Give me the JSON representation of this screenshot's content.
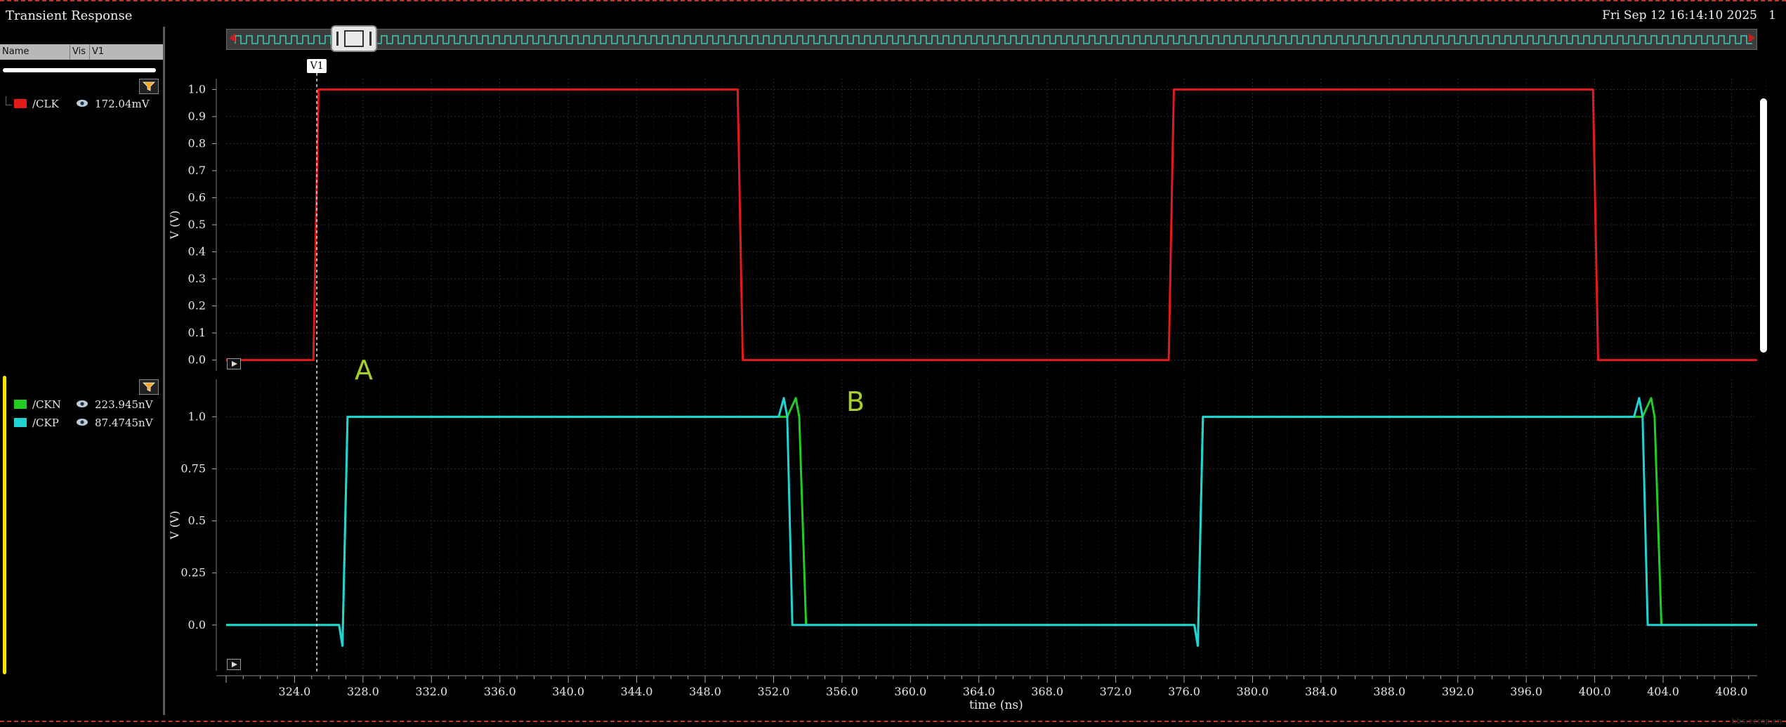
{
  "window": {
    "title": "Transient Response",
    "datetime": "Fri Sep 12 16:14:10 2025",
    "edge_text": "1"
  },
  "legend": {
    "headers": {
      "name": "Name",
      "vis": "Vis",
      "v1": "V1"
    },
    "strip1": [
      {
        "name": "/CLK",
        "value": "172.04mV",
        "color": "#e41a1a"
      }
    ],
    "strip2": [
      {
        "name": "/CKN",
        "value": "223.945nV",
        "color": "#22cc22"
      },
      {
        "name": "/CKP",
        "value": "87.4745nV",
        "color": "#22d3d3"
      }
    ],
    "eye_icon": "eye-icon",
    "filter_icon": "filter-icon"
  },
  "marker": {
    "label": "V1",
    "x_ns": 325.3
  },
  "annotations": {
    "a": "A",
    "b": "B"
  },
  "accent_colors": {
    "panel_bar": "#f2e600",
    "annotation": "#a6cf2a",
    "border": "#c0392b"
  },
  "chart_data": [
    {
      "type": "line",
      "title": "",
      "xlabel": "time (ns)",
      "ylabel": "V (V)",
      "xlim": [
        320.0,
        409.5
      ],
      "ylim": [
        -0.04,
        1.04
      ],
      "yticks": [
        "0.0",
        "0.1",
        "0.2",
        "0.3",
        "0.4",
        "0.5",
        "0.6",
        "0.7",
        "0.8",
        "0.9",
        "1.0"
      ],
      "grid": true,
      "series": [
        {
          "name": "/CLK",
          "color": "#e41a1a",
          "points": [
            [
              320.0,
              0.0
            ],
            [
              325.1,
              0.0
            ],
            [
              325.4,
              1.0
            ],
            [
              349.9,
              1.0
            ],
            [
              350.2,
              0.0
            ],
            [
              375.1,
              0.0
            ],
            [
              375.4,
              1.0
            ],
            [
              399.9,
              1.0
            ],
            [
              400.2,
              0.0
            ],
            [
              409.5,
              0.0
            ]
          ]
        }
      ]
    },
    {
      "type": "line",
      "title": "",
      "xlabel": "time (ns)",
      "ylabel": "V (V)",
      "xlim": [
        320.0,
        409.5
      ],
      "ylim": [
        -0.22,
        1.18
      ],
      "yticks": [
        "0.0",
        "0.25",
        "0.5",
        "0.75",
        "1.0"
      ],
      "xticks": [
        "324.0",
        "328.0",
        "332.0",
        "336.0",
        "340.0",
        "344.0",
        "348.0",
        "352.0",
        "356.0",
        "360.0",
        "364.0",
        "368.0",
        "372.0",
        "376.0",
        "380.0",
        "384.0",
        "388.0",
        "392.0",
        "396.0",
        "400.0",
        "404.0",
        "408.0"
      ],
      "grid": true,
      "series": [
        {
          "name": "/CKN",
          "color": "#22cc22",
          "points": [
            [
              320.0,
              0.0
            ],
            [
              326.6,
              0.0
            ],
            [
              326.8,
              -0.1
            ],
            [
              327.1,
              1.0
            ],
            [
              352.8,
              1.0
            ],
            [
              353.3,
              1.09
            ],
            [
              353.5,
              1.0
            ],
            [
              353.9,
              0.0
            ],
            [
              376.6,
              0.0
            ],
            [
              376.8,
              -0.1
            ],
            [
              377.1,
              1.0
            ],
            [
              402.8,
              1.0
            ],
            [
              403.3,
              1.09
            ],
            [
              403.5,
              1.0
            ],
            [
              403.9,
              0.0
            ],
            [
              409.5,
              0.0
            ]
          ]
        },
        {
          "name": "/CKP",
          "color": "#22d3d3",
          "points": [
            [
              320.0,
              0.0
            ],
            [
              326.6,
              0.0
            ],
            [
              326.8,
              -0.1
            ],
            [
              327.1,
              1.0
            ],
            [
              352.3,
              1.0
            ],
            [
              352.6,
              1.09
            ],
            [
              352.8,
              1.0
            ],
            [
              353.1,
              0.0
            ],
            [
              376.6,
              0.0
            ],
            [
              376.8,
              -0.1
            ],
            [
              377.1,
              1.0
            ],
            [
              402.3,
              1.0
            ],
            [
              402.6,
              1.09
            ],
            [
              402.8,
              1.0
            ],
            [
              403.1,
              0.0
            ],
            [
              409.5,
              0.0
            ]
          ]
        }
      ]
    }
  ]
}
